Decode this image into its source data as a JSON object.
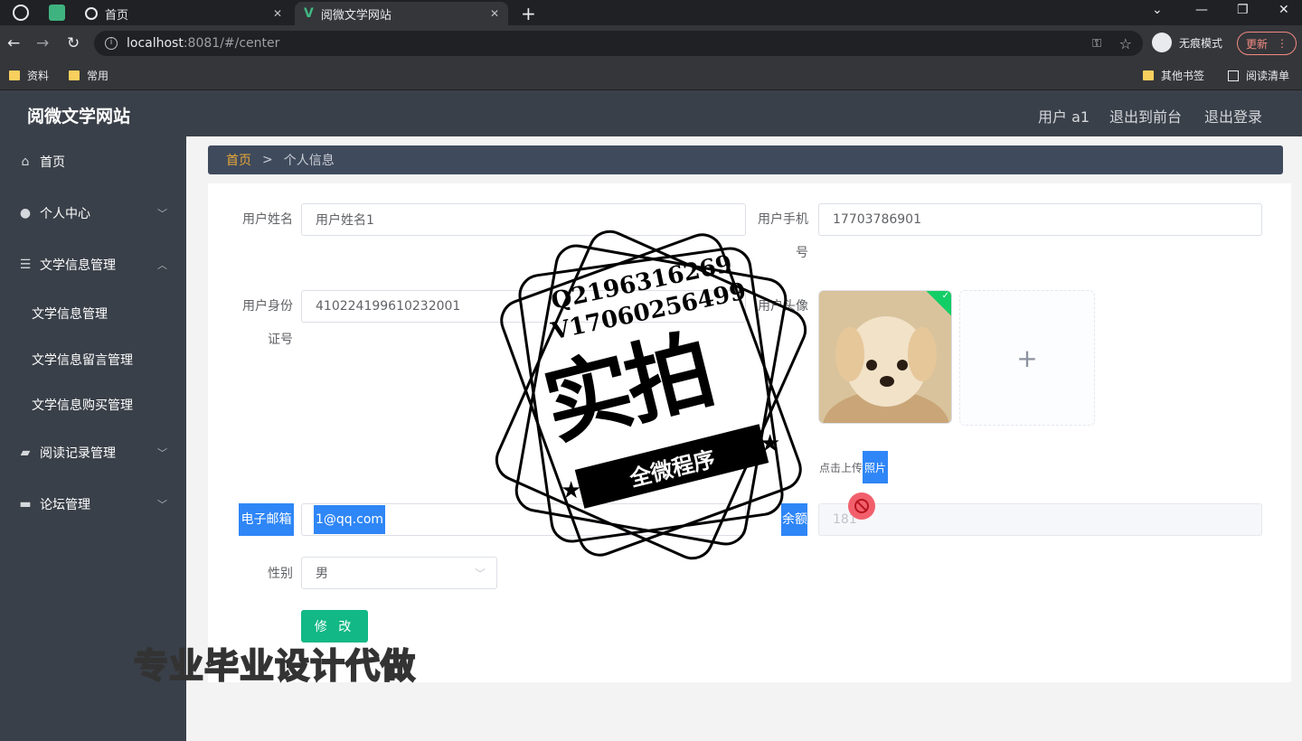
{
  "browser": {
    "tabs": [
      {
        "label": "首页"
      },
      {
        "label": "阅微文学网站"
      }
    ],
    "url_host": "localhost",
    "url_path": ":8081/#/center",
    "incognito_label": "无痕模式",
    "update_label": "更新",
    "bookmarks": [
      "资料",
      "常用"
    ],
    "bookmarks_right": [
      "其他书签",
      "阅读清单"
    ]
  },
  "header": {
    "title": "阅微文学网站",
    "user": "用户 a1",
    "back_front": "退出到前台",
    "logout": "退出登录"
  },
  "sidebar": {
    "items": [
      {
        "label": "首页",
        "icon": "home-icon"
      },
      {
        "label": "个人中心",
        "icon": "user-icon"
      },
      {
        "label": "文学信息管理",
        "icon": "list-icon"
      },
      {
        "label": "阅读记录管理",
        "icon": "record-icon"
      },
      {
        "label": "论坛管理",
        "icon": "monitor-icon"
      }
    ],
    "sub_items": [
      "文学信息管理",
      "文学信息留言管理",
      "文学信息购买管理"
    ]
  },
  "breadcrumb": {
    "home": "首页",
    "sep": ">",
    "current": "个人信息"
  },
  "form": {
    "name_label": "用户姓名",
    "name_value": "用户姓名1",
    "phone_label_1": "用户手机",
    "phone_label_2": "号",
    "phone_value": "17703786901",
    "idcard_label_1": "用户身份",
    "idcard_label_2": "证号",
    "idcard_value": "410224199610232001",
    "avatar_label": "用户头像",
    "upload_tip_1": "点击上传",
    "upload_tip_2": "照片",
    "email_label": "电子邮箱",
    "email_value": "1@qq.com",
    "balance_label": "余额",
    "balance_value": "181",
    "gender_label": "性别",
    "gender_value": "男",
    "submit": "修 改"
  },
  "watermark": {
    "line1": "Q2196316269",
    "line2": "V17060256499",
    "big": "实拍",
    "ribbon": "全微程序",
    "bottom": "专业毕业设计代做"
  }
}
